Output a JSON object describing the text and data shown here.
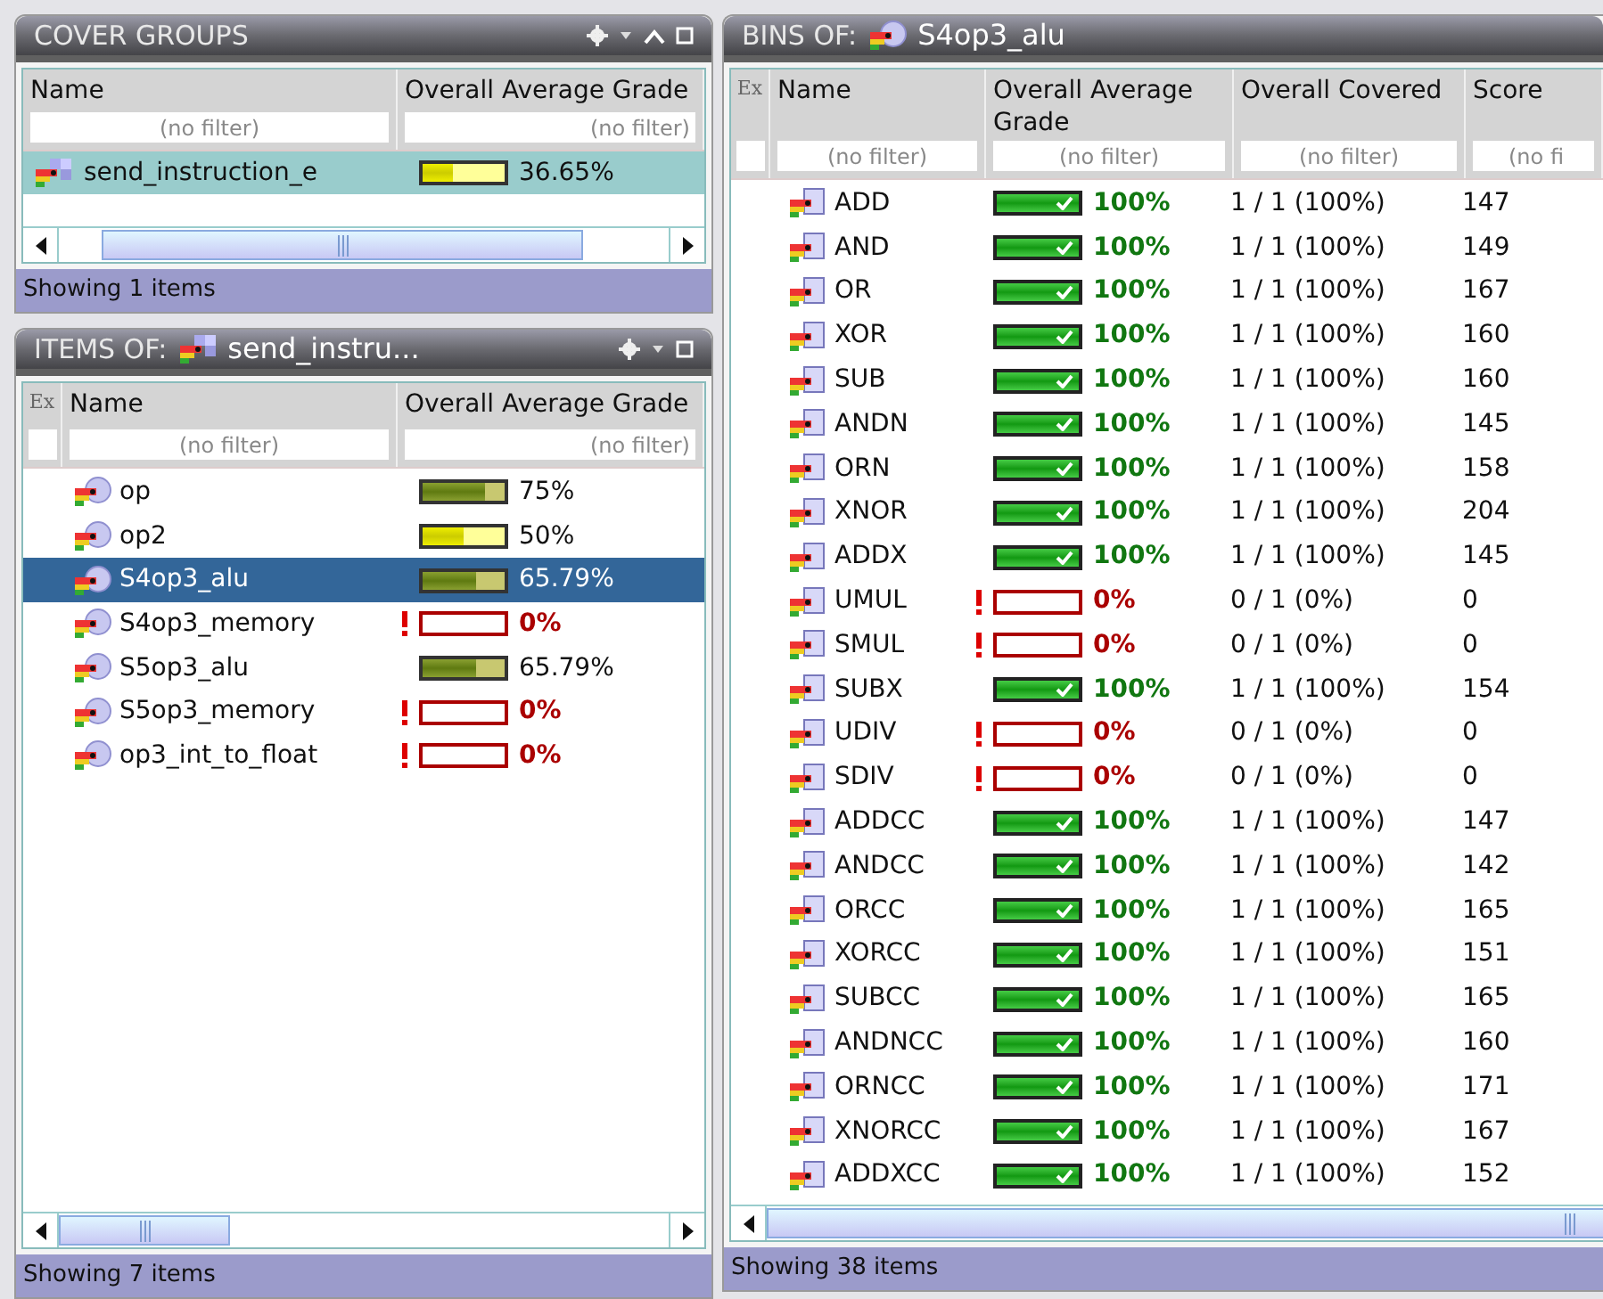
{
  "cover_groups": {
    "title": "COVER GROUPS",
    "columns": [
      {
        "label": "Name",
        "placeholder": "(no filter)"
      },
      {
        "label": "Overall Average Grade",
        "placeholder": "(no filter)"
      }
    ],
    "rows": [
      {
        "name": "send_instruction_e",
        "selected": true,
        "grade": {
          "kind": "yellow",
          "level": 0.37,
          "text": "36.65%"
        }
      }
    ],
    "status": "Showing 1 items"
  },
  "items": {
    "title": "ITEMS OF:",
    "title_name": "send_instru...",
    "ex_label": "Ex",
    "columns": [
      {
        "label": "Name",
        "placeholder": "(no filter)"
      },
      {
        "label": "Overall Average Grade",
        "placeholder": "(no filter)"
      }
    ],
    "rows": [
      {
        "name": "op",
        "selected": false,
        "grade": {
          "kind": "olive",
          "level": 0.75,
          "text": "75%"
        }
      },
      {
        "name": "op2",
        "selected": false,
        "grade": {
          "kind": "yellow",
          "level": 0.5,
          "text": "50%"
        }
      },
      {
        "name": "S4op3_alu",
        "selected": true,
        "grade": {
          "kind": "olive",
          "level": 0.66,
          "text": "65.79%"
        }
      },
      {
        "name": "S4op3_memory",
        "selected": false,
        "grade": {
          "kind": "zero",
          "level": 0,
          "text": "0%"
        }
      },
      {
        "name": "S5op3_alu",
        "selected": false,
        "grade": {
          "kind": "olive",
          "level": 0.66,
          "text": "65.79%"
        }
      },
      {
        "name": "S5op3_memory",
        "selected": false,
        "grade": {
          "kind": "zero",
          "level": 0,
          "text": "0%"
        }
      },
      {
        "name": "op3_int_to_float",
        "selected": false,
        "grade": {
          "kind": "zero",
          "level": 0,
          "text": "0%"
        }
      }
    ],
    "status": "Showing 7 items"
  },
  "bins": {
    "title": "BINS OF:",
    "title_name": "S4op3_alu",
    "ex_label": "Ex",
    "columns": [
      {
        "label": "Name",
        "placeholder": "(no filter)"
      },
      {
        "label": "Overall Average Grade",
        "placeholder": "(no filter)"
      },
      {
        "label": "Overall Covered",
        "placeholder": "(no filter)"
      },
      {
        "label": "Score",
        "placeholder": "(no fi"
      }
    ],
    "rows": [
      {
        "name": "ADD",
        "grade": {
          "kind": "complete",
          "level": 1,
          "text": "100%"
        },
        "covered": "1 / 1 (100%)",
        "score": "147"
      },
      {
        "name": "AND",
        "grade": {
          "kind": "complete",
          "level": 1,
          "text": "100%"
        },
        "covered": "1 / 1 (100%)",
        "score": "149"
      },
      {
        "name": "OR",
        "grade": {
          "kind": "complete",
          "level": 1,
          "text": "100%"
        },
        "covered": "1 / 1 (100%)",
        "score": "167"
      },
      {
        "name": "XOR",
        "grade": {
          "kind": "complete",
          "level": 1,
          "text": "100%"
        },
        "covered": "1 / 1 (100%)",
        "score": "160"
      },
      {
        "name": "SUB",
        "grade": {
          "kind": "complete",
          "level": 1,
          "text": "100%"
        },
        "covered": "1 / 1 (100%)",
        "score": "160"
      },
      {
        "name": "ANDN",
        "grade": {
          "kind": "complete",
          "level": 1,
          "text": "100%"
        },
        "covered": "1 / 1 (100%)",
        "score": "145"
      },
      {
        "name": "ORN",
        "grade": {
          "kind": "complete",
          "level": 1,
          "text": "100%"
        },
        "covered": "1 / 1 (100%)",
        "score": "158"
      },
      {
        "name": "XNOR",
        "grade": {
          "kind": "complete",
          "level": 1,
          "text": "100%"
        },
        "covered": "1 / 1 (100%)",
        "score": "204"
      },
      {
        "name": "ADDX",
        "grade": {
          "kind": "complete",
          "level": 1,
          "text": "100%"
        },
        "covered": "1 / 1 (100%)",
        "score": "145"
      },
      {
        "name": "UMUL",
        "grade": {
          "kind": "zero",
          "level": 0,
          "text": "0%"
        },
        "covered": "0 / 1 (0%)",
        "score": "0"
      },
      {
        "name": "SMUL",
        "grade": {
          "kind": "zero",
          "level": 0,
          "text": "0%"
        },
        "covered": "0 / 1 (0%)",
        "score": "0"
      },
      {
        "name": "SUBX",
        "grade": {
          "kind": "complete",
          "level": 1,
          "text": "100%"
        },
        "covered": "1 / 1 (100%)",
        "score": "154"
      },
      {
        "name": "UDIV",
        "grade": {
          "kind": "zero",
          "level": 0,
          "text": "0%"
        },
        "covered": "0 / 1 (0%)",
        "score": "0"
      },
      {
        "name": "SDIV",
        "grade": {
          "kind": "zero",
          "level": 0,
          "text": "0%"
        },
        "covered": "0 / 1 (0%)",
        "score": "0"
      },
      {
        "name": "ADDCC",
        "grade": {
          "kind": "complete",
          "level": 1,
          "text": "100%"
        },
        "covered": "1 / 1 (100%)",
        "score": "147"
      },
      {
        "name": "ANDCC",
        "grade": {
          "kind": "complete",
          "level": 1,
          "text": "100%"
        },
        "covered": "1 / 1 (100%)",
        "score": "142"
      },
      {
        "name": "ORCC",
        "grade": {
          "kind": "complete",
          "level": 1,
          "text": "100%"
        },
        "covered": "1 / 1 (100%)",
        "score": "165"
      },
      {
        "name": "XORCC",
        "grade": {
          "kind": "complete",
          "level": 1,
          "text": "100%"
        },
        "covered": "1 / 1 (100%)",
        "score": "151"
      },
      {
        "name": "SUBCC",
        "grade": {
          "kind": "complete",
          "level": 1,
          "text": "100%"
        },
        "covered": "1 / 1 (100%)",
        "score": "165"
      },
      {
        "name": "ANDNCC",
        "grade": {
          "kind": "complete",
          "level": 1,
          "text": "100%"
        },
        "covered": "1 / 1 (100%)",
        "score": "160"
      },
      {
        "name": "ORNCC",
        "grade": {
          "kind": "complete",
          "level": 1,
          "text": "100%"
        },
        "covered": "1 / 1 (100%)",
        "score": "171"
      },
      {
        "name": "XNORCC",
        "grade": {
          "kind": "complete",
          "level": 1,
          "text": "100%"
        },
        "covered": "1 / 1 (100%)",
        "score": "167"
      },
      {
        "name": "ADDXCC",
        "grade": {
          "kind": "complete",
          "level": 1,
          "text": "100%"
        },
        "covered": "1 / 1 (100%)",
        "score": "152"
      }
    ],
    "status": "Showing 38 items"
  }
}
